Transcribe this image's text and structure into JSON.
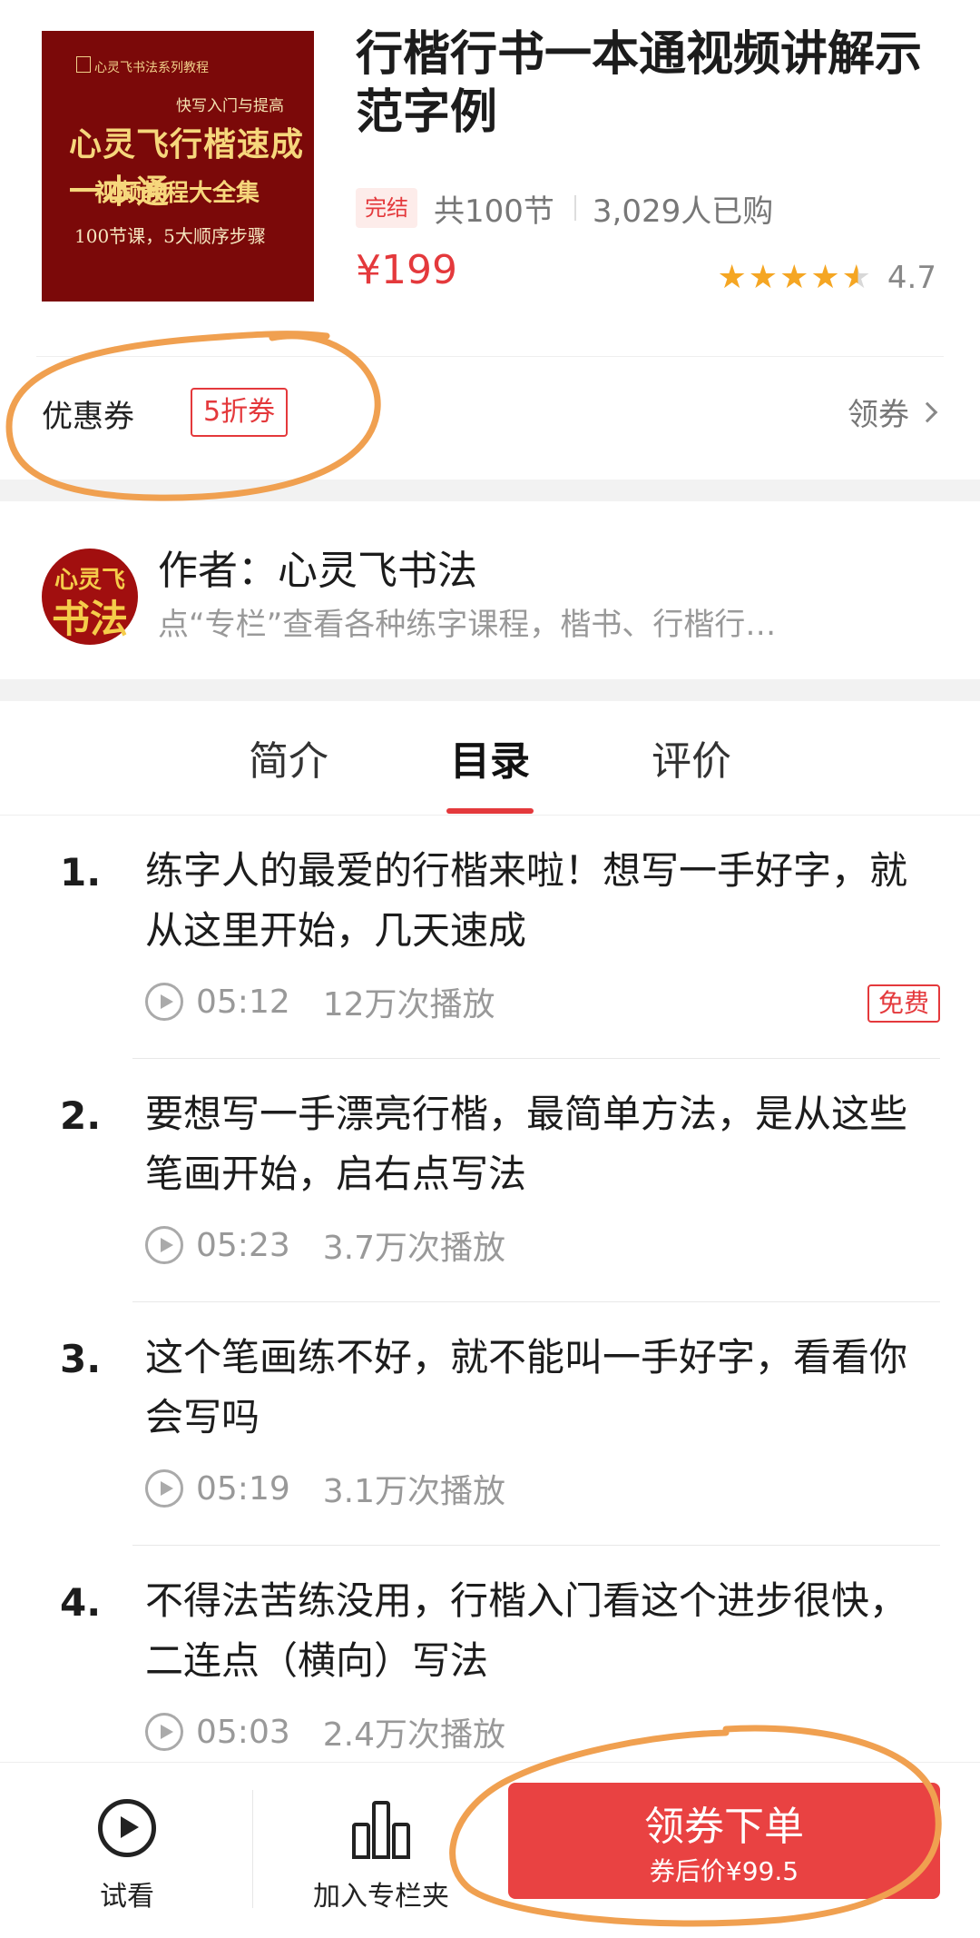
{
  "product": {
    "cover": {
      "series": "心灵飞书法系列教程",
      "subtitle": "快写入门与提高",
      "headline": "心灵飞行楷速成一本通",
      "course": "视频教程大全集",
      "lessons": "100节课，5大顺序步骤"
    },
    "title": "行楷行书一本通视频讲解示范字例",
    "status_badge": "完结",
    "lesson_count": "共100节",
    "buyers": "3,029人已购",
    "price": "¥199",
    "rating": "4.7",
    "rating_stars": 4.5
  },
  "coupon": {
    "label": "优惠券",
    "tag": "5折券",
    "link": "领券"
  },
  "author": {
    "avatar_top": "心灵飞",
    "avatar_bottom": "书法",
    "name": "作者：心灵飞书法",
    "desc": "点“专栏”查看各种练字课程，楷书、行楷行…"
  },
  "tabs": [
    {
      "label": "简介"
    },
    {
      "label": "目录"
    },
    {
      "label": "评价"
    }
  ],
  "lessons": [
    {
      "num": "1.",
      "title": "练字人的最爱的行楷来啦！想写一手好字，就从这里开始，几天速成",
      "duration": "05:12",
      "plays": "12万次播放",
      "tag": "免费"
    },
    {
      "num": "2.",
      "title": "要想写一手漂亮行楷，最简单方法，是从这些笔画开始，启右点写法",
      "duration": "05:23",
      "plays": "3.7万次播放"
    },
    {
      "num": "3.",
      "title": "这个笔画练不好，就不能叫一手好字，看看你会写吗",
      "duration": "05:19",
      "plays": "3.1万次播放"
    },
    {
      "num": "4.",
      "title": "不得法苦练没用，行楷入门看这个进步很快，二连点（横向）写法",
      "duration": "05:03",
      "plays": "2.4万次播放"
    }
  ],
  "bottom_bar": {
    "try_label": "试看",
    "add_label": "加入专栏夹",
    "buy_label": "领券下单",
    "buy_sub": "券后价¥99.5"
  },
  "colors": {
    "accent": "#e4393c",
    "button": "#e94242",
    "annotation": "#f0a050"
  }
}
